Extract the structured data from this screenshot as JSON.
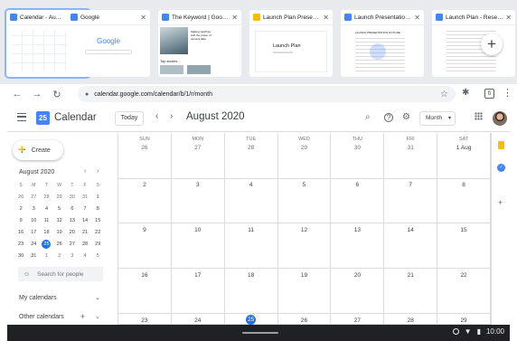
{
  "tabs": [
    {
      "title": "Calendar - Au...",
      "favicon_color": "#4285f4",
      "active": true
    },
    {
      "title": "Google",
      "favicon_color": "#4285f4",
      "active": false
    },
    {
      "title": "The Keyword | Google",
      "favicon_color": "#4285f4",
      "active": false
    },
    {
      "title": "Launch Plan Presentat...",
      "favicon_color": "#fbbc04",
      "active": false
    },
    {
      "title": "Launch Presentation ...",
      "favicon_color": "#4285f4",
      "active": false
    },
    {
      "title": "Launch Plan - Resear...",
      "favicon_color": "#4285f4",
      "active": false
    }
  ],
  "tab_thumbs": {
    "google_logo": "Google",
    "keyword_caption": "Top stories",
    "keyword_headline": "Making switches with the power of camera data",
    "slides_title": "Launch Plan",
    "doc_heading": "LAUNCH PRESENTATION OUTLINE"
  },
  "newtab_icon": "+",
  "toolbar": {
    "back": "←",
    "forward": "→",
    "reload": "↻",
    "url": "calendar.google.com/calendar/b/1/r/month",
    "tab_count": "6"
  },
  "header": {
    "logo_text": "25",
    "app_name": "Calendar",
    "today_label": "Today",
    "month_title": "August 2020",
    "view_label": "Month"
  },
  "sidebar": {
    "create_label": "Create",
    "mini_title": "August 2020",
    "search_people_placeholder": "Search for people",
    "my_calendars": "My calendars",
    "other_calendars": "Other calendars"
  },
  "mini_calendar": {
    "weekdays": [
      "S",
      "M",
      "T",
      "W",
      "T",
      "F",
      "S"
    ],
    "weeks": [
      [
        {
          "d": "26",
          "o": true
        },
        {
          "d": "27",
          "o": true
        },
        {
          "d": "28",
          "o": true
        },
        {
          "d": "29",
          "o": true
        },
        {
          "d": "30",
          "o": true
        },
        {
          "d": "31",
          "o": true
        },
        {
          "d": "1"
        }
      ],
      [
        {
          "d": "2"
        },
        {
          "d": "3"
        },
        {
          "d": "4"
        },
        {
          "d": "5"
        },
        {
          "d": "6"
        },
        {
          "d": "7"
        },
        {
          "d": "8"
        }
      ],
      [
        {
          "d": "9"
        },
        {
          "d": "10"
        },
        {
          "d": "11"
        },
        {
          "d": "12"
        },
        {
          "d": "13"
        },
        {
          "d": "14"
        },
        {
          "d": "15"
        }
      ],
      [
        {
          "d": "16"
        },
        {
          "d": "17"
        },
        {
          "d": "18"
        },
        {
          "d": "19"
        },
        {
          "d": "20"
        },
        {
          "d": "21"
        },
        {
          "d": "22"
        }
      ],
      [
        {
          "d": "23"
        },
        {
          "d": "24"
        },
        {
          "d": "25",
          "t": true
        },
        {
          "d": "26"
        },
        {
          "d": "27"
        },
        {
          "d": "28"
        },
        {
          "d": "29"
        }
      ],
      [
        {
          "d": "30"
        },
        {
          "d": "31"
        },
        {
          "d": "1",
          "o": true
        },
        {
          "d": "2",
          "o": true
        },
        {
          "d": "3",
          "o": true
        },
        {
          "d": "4",
          "o": true
        },
        {
          "d": "5",
          "o": true
        }
      ]
    ]
  },
  "month_grid": {
    "weekdays": [
      "SUN",
      "MON",
      "TUE",
      "WED",
      "THU",
      "FRI",
      "SAT"
    ],
    "weeks": [
      [
        {
          "d": "26",
          "o": true
        },
        {
          "d": "27",
          "o": true
        },
        {
          "d": "28",
          "o": true
        },
        {
          "d": "29",
          "o": true
        },
        {
          "d": "30",
          "o": true
        },
        {
          "d": "31",
          "o": true
        },
        {
          "d": "1 Aug"
        }
      ],
      [
        {
          "d": "2"
        },
        {
          "d": "3"
        },
        {
          "d": "4"
        },
        {
          "d": "5"
        },
        {
          "d": "6"
        },
        {
          "d": "7"
        },
        {
          "d": "8"
        }
      ],
      [
        {
          "d": "9"
        },
        {
          "d": "10"
        },
        {
          "d": "11"
        },
        {
          "d": "12"
        },
        {
          "d": "13"
        },
        {
          "d": "14"
        },
        {
          "d": "15"
        }
      ],
      [
        {
          "d": "16"
        },
        {
          "d": "17"
        },
        {
          "d": "18"
        },
        {
          "d": "19"
        },
        {
          "d": "20"
        },
        {
          "d": "21"
        },
        {
          "d": "22"
        }
      ],
      [
        {
          "d": "23"
        },
        {
          "d": "24"
        },
        {
          "d": "25",
          "t": true
        },
        {
          "d": "26"
        },
        {
          "d": "27"
        },
        {
          "d": "28"
        },
        {
          "d": "29"
        }
      ]
    ]
  },
  "shelf": {
    "time": "10:00"
  },
  "colors": {
    "accent": "#1a73e8",
    "tab_strip": "#e8eaed",
    "grid_line": "#dadce0"
  }
}
